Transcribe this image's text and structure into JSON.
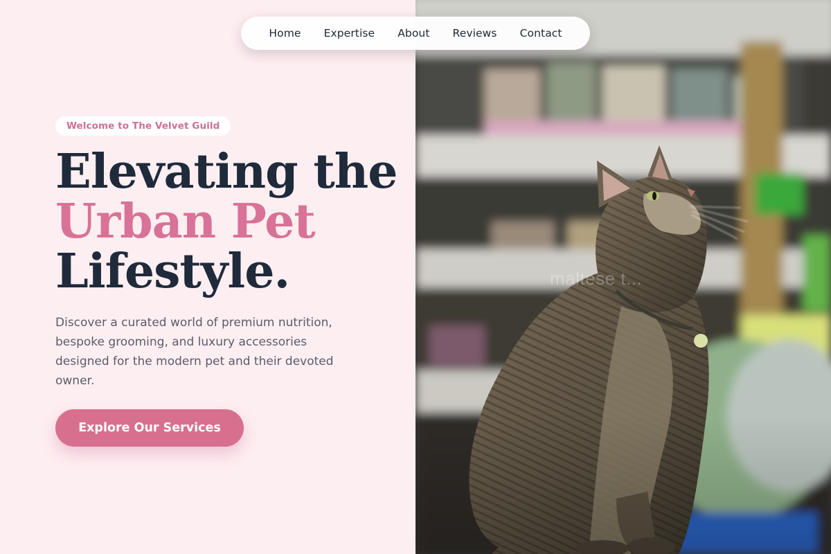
{
  "nav": {
    "items": [
      {
        "label": "Home"
      },
      {
        "label": "Expertise"
      },
      {
        "label": "About"
      },
      {
        "label": "Reviews"
      },
      {
        "label": "Contact"
      }
    ]
  },
  "hero": {
    "eyebrow": "Welcome to The Velvet Guild",
    "headline": {
      "line1": "Elevating the",
      "line2": "Urban Pet",
      "line3": "Lifestyle."
    },
    "description": "Discover a curated world of premium nutrition, bespoke grooming, and luxury accessories designed for the modern pet and their devoted owner.",
    "cta_label": "Explore Our Services"
  },
  "image": {
    "subject": "tabby cat sitting in a pet store aisle",
    "watermark": "maltese t..."
  },
  "colors": {
    "background": "#fdeef2",
    "accent": "#d7708f",
    "heading": "#1f2a3a",
    "body_text": "#5b5c66"
  }
}
